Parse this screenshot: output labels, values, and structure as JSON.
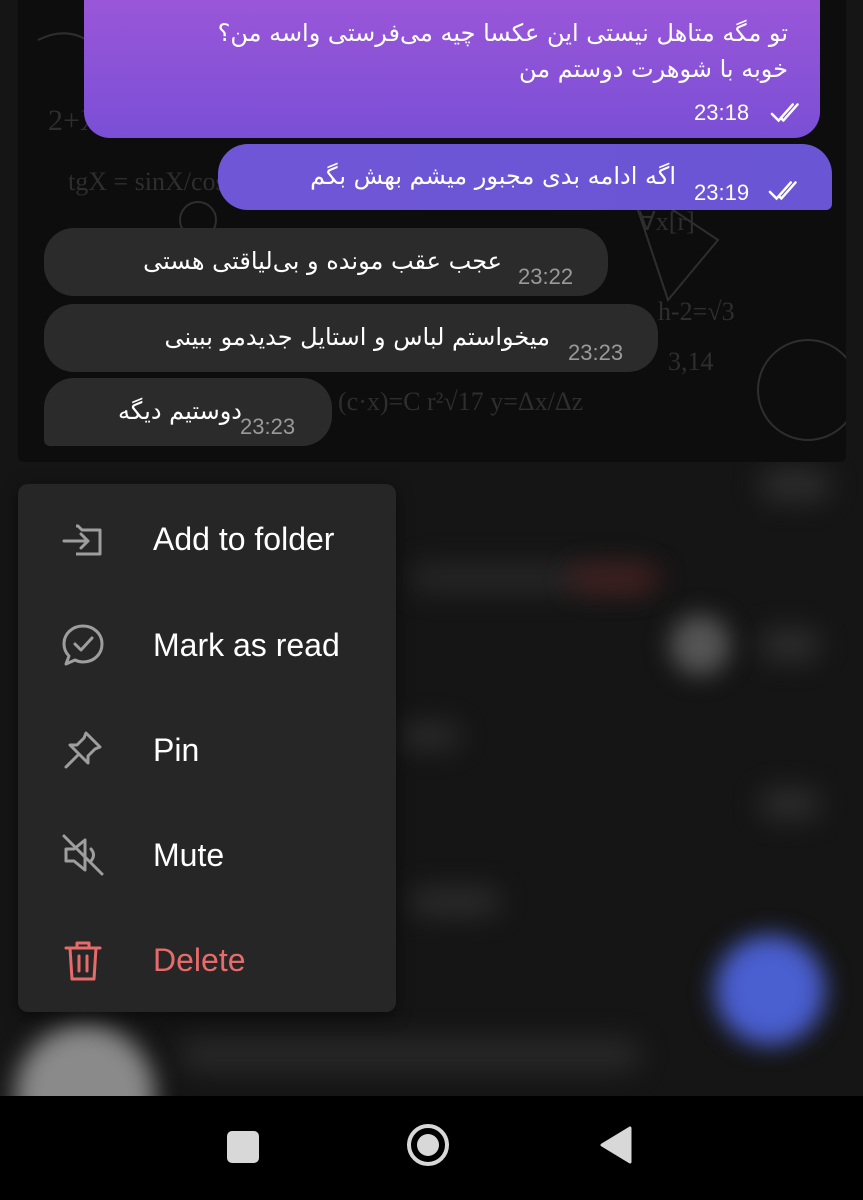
{
  "chat": {
    "messages": [
      {
        "direction": "out",
        "text_line1": "تو مگه متاهل نیستی این عکسا چیه می‌فرستی واسه من؟",
        "text_line2": "خوبه با شوهرت دوستم من",
        "time": "23:18",
        "status": "read"
      },
      {
        "direction": "out",
        "text": "اگه ادامه بدی مجبور میشم بهش بگم",
        "time": "23:19",
        "status": "read"
      },
      {
        "direction": "in",
        "text": "عجب عقب مونده و بی‌لیاقتی هستی",
        "time": "23:22"
      },
      {
        "direction": "in",
        "text": "میخواستم لباس و استایل جدیدمو ببینی",
        "time": "23:23"
      },
      {
        "direction": "in",
        "text": "دوستیم دیگه",
        "time": "23:23"
      }
    ],
    "colors": {
      "outgoing_top": "#9a56d8",
      "outgoing_bottom": "#7a4fd6",
      "incoming": "#2b2b2b"
    }
  },
  "context_menu": {
    "items": [
      {
        "label": "Add to folder",
        "icon": "folder-add-icon"
      },
      {
        "label": "Mark as read",
        "icon": "chat-check-icon"
      },
      {
        "label": "Pin",
        "icon": "pin-icon"
      },
      {
        "label": "Mute",
        "icon": "mute-icon"
      },
      {
        "label": "Delete",
        "icon": "trash-icon",
        "color": "#e86a6a"
      }
    ]
  },
  "navbar": {
    "buttons": [
      {
        "icon": "recents-icon"
      },
      {
        "icon": "home-icon"
      },
      {
        "icon": "back-icon"
      }
    ]
  }
}
